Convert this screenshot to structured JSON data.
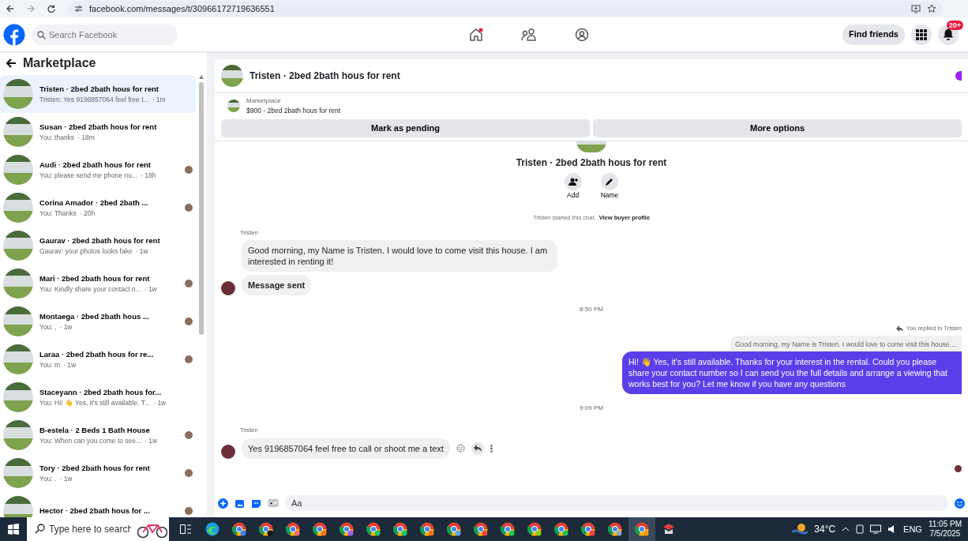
{
  "browser": {
    "url": "facebook.com/messages/t/30966172719636551"
  },
  "header": {
    "search_placeholder": "Search Facebook",
    "find_friends": "Find friends",
    "notification_badge": "20+",
    "home_unread": true
  },
  "sidebar": {
    "title": "Marketplace",
    "items": [
      {
        "title": "Tristen · 2bed 2bath hous for rent",
        "preview": "Tristen: Yes 9196857064 feel free t...",
        "time": "· 1m",
        "selected": true,
        "seen": false
      },
      {
        "title": "Susan · 2bed 2bath hous for rent",
        "preview": "You: thanks",
        "time": "· 18m",
        "selected": false,
        "seen": false
      },
      {
        "title": "Audi · 2bed 2bath hous for rent",
        "preview": "You: please send me phone nu...",
        "time": "· 18h",
        "selected": false,
        "seen": true
      },
      {
        "title": "Corina Amador · 2bed 2bath ...",
        "preview": "You: Thanks",
        "time": "· 20h",
        "selected": false,
        "seen": true
      },
      {
        "title": "Gaurav · 2bed 2bath hous for rent",
        "preview": "Gaurav: your photos looks fake",
        "time": "· 1w",
        "selected": false,
        "seen": false
      },
      {
        "title": "Mari · 2bed 2bath hous for rent",
        "preview": "You: Kindly share your contact n...",
        "time": "· 1w",
        "selected": false,
        "seen": true
      },
      {
        "title": "Montaega · 2bed 2bath hous ...",
        "preview": "You: ,",
        "time": "· 1w",
        "selected": false,
        "seen": true
      },
      {
        "title": "Laraa · 2bed 2bath hous for re...",
        "preview": "You: m",
        "time": "· 1w",
        "selected": false,
        "seen": true
      },
      {
        "title": "Staceyann · 2bed 2bath hous for...",
        "preview": "You: Hi! 👋 Yes, it's still available. T...",
        "time": "· 1w",
        "selected": false,
        "seen": false
      },
      {
        "title": "B-estela · 2 Beds 1 Bath House",
        "preview": "You: When can you come to see...",
        "time": "· 1w",
        "selected": false,
        "seen": true
      },
      {
        "title": "Tory · 2bed 2bath hous for rent",
        "preview": "You: .",
        "time": "· 1w",
        "selected": false,
        "seen": true
      },
      {
        "title": "Hector · 2bed 2bath hous for ...",
        "selected": false,
        "seen": true
      }
    ]
  },
  "chat": {
    "title": "Tristen · 2bed 2bath hous for rent",
    "listing_label": "Marketplace",
    "listing": "$900 - 2bed 2bath hous for rent",
    "actions": [
      "Mark as pending",
      "More options"
    ],
    "profile_title": "Tristen · 2bed 2bath hous for rent",
    "profile_actions": [
      {
        "label": "Add",
        "kind": "add"
      },
      {
        "label": "Name",
        "kind": "name"
      }
    ],
    "started": "Tristen started this chat.",
    "view_profile": "View buyer profile",
    "messages": [
      {
        "kind": "sender",
        "text": "Tristen"
      },
      {
        "kind": "incoming",
        "text": "Good morning, my Name is Tristen. I would love to come visit this house. I am interested in renting it!",
        "avatar": false
      },
      {
        "kind": "incoming",
        "text": "Message sent",
        "avatar": true,
        "bold": true
      },
      {
        "kind": "timestamp",
        "text": "8:50 PM"
      },
      {
        "kind": "reply_label",
        "text": "You replied to Tristen"
      },
      {
        "kind": "quoted",
        "text": "Good morning, my Name is Tristen. I would love to come visit this house...."
      },
      {
        "kind": "outgoing",
        "text": "Hi! 👋 Yes, it's still available. Thanks for your interest in the rental. Could you please share your contact number so I can send you the full details and arrange a viewing that works best for you? Let me know if you have any questions"
      },
      {
        "kind": "timestamp",
        "text": "9:09 PM"
      },
      {
        "kind": "sender",
        "text": "Tristen"
      },
      {
        "kind": "incoming",
        "text": "Yes 9196857064 feel free to call or shoot me a text",
        "avatar": true,
        "tools": true
      }
    ],
    "composer_placeholder": "Aa"
  },
  "taskbar": {
    "search_placeholder": "Type here to search",
    "temperature": "34°C",
    "language": "ENG",
    "time": "11:05 PM",
    "date": "7/5/2025"
  }
}
